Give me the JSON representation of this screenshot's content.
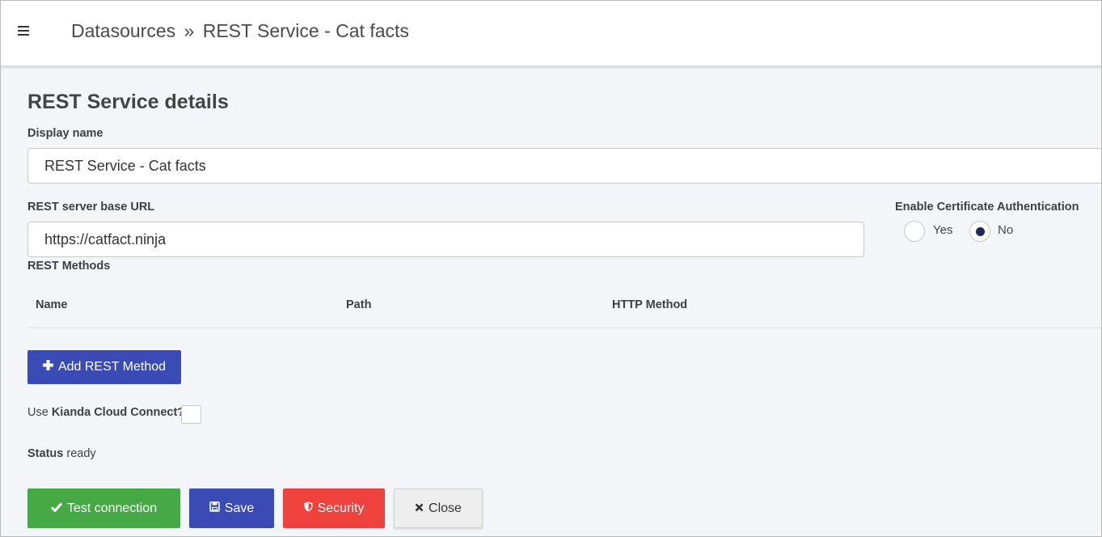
{
  "header": {
    "breadcrumb_root": "Datasources",
    "breadcrumb_sep": "»",
    "breadcrumb_current": "REST Service - Cat facts"
  },
  "form": {
    "section_title": "REST Service details",
    "display_name_label": "Display name",
    "display_name_value": "REST Service - Cat facts",
    "base_url_label": "REST server base URL",
    "base_url_value": "https://catfact.ninja",
    "cert_auth_label": "Enable Certificate Authentication",
    "cert_auth_options": [
      {
        "label": "Yes",
        "checked": false
      },
      {
        "label": "No",
        "checked": true
      }
    ],
    "methods_label": "REST Methods",
    "methods_columns": [
      "Name",
      "Path",
      "HTTP Method"
    ],
    "methods_rows": [],
    "add_method_label": "Add REST Method",
    "cloud_connect_prefix": "Use",
    "cloud_connect_bold": "Kianda Cloud Connect?",
    "cloud_connect_checked": false,
    "status_label": "Status",
    "status_value": "ready"
  },
  "actions": {
    "test_connection": "Test connection",
    "save": "Save",
    "security": "Security",
    "close": "Close"
  },
  "colors": {
    "primary": "#3b4bb5",
    "success": "#45aa46",
    "danger": "#f0423c",
    "radio_selected": "#20265a"
  },
  "icons": {
    "menu": "hamburger-icon",
    "add": "plus-icon",
    "test": "check-icon",
    "save": "floppy-icon",
    "security": "shield-icon",
    "close": "x-icon"
  }
}
